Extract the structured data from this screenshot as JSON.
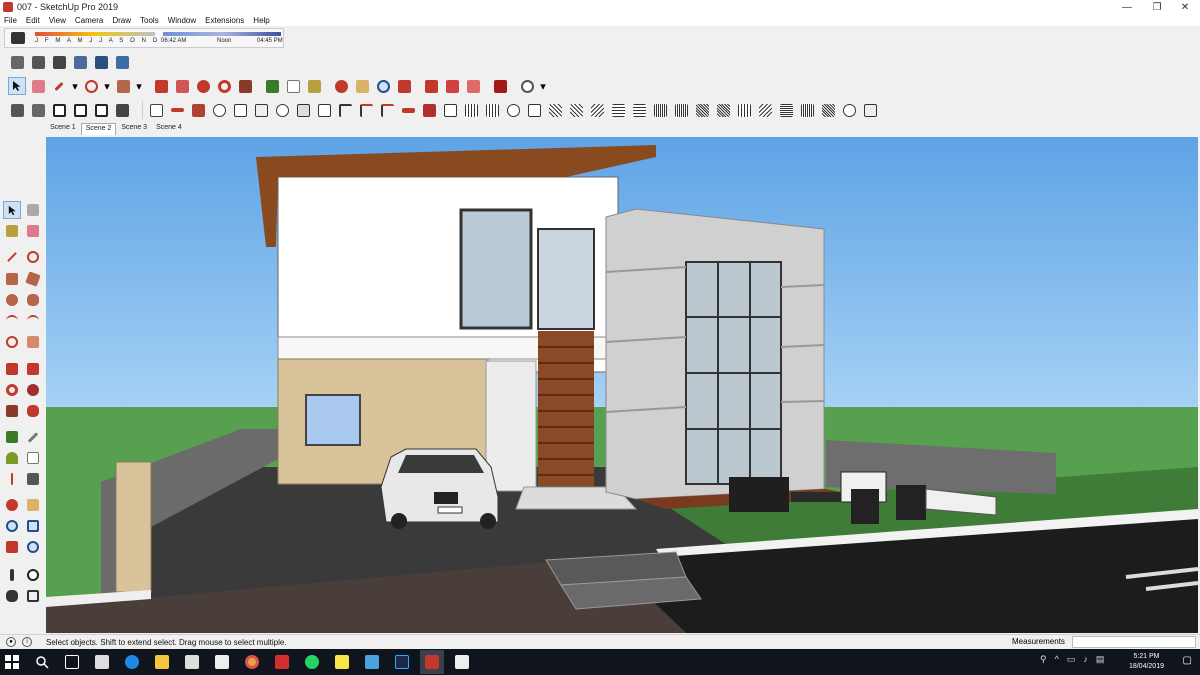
{
  "window": {
    "title": "007 - SketchUp Pro 2019",
    "minimize_glyph": "—",
    "restore_glyph": "❐",
    "close_glyph": "✕"
  },
  "menu": [
    "File",
    "Edit",
    "View",
    "Camera",
    "Draw",
    "Tools",
    "Window",
    "Extensions",
    "Help"
  ],
  "shadows": {
    "months": "J F M A M J J A S O N D",
    "time_start": "06:42 AM",
    "time_noon": "Noon",
    "time_end": "04:45 PM"
  },
  "scenes": [
    "Scene 1",
    "Scene 2",
    "Scene 3",
    "Scene 4"
  ],
  "active_scene_index": 1,
  "status": {
    "hint": "Select objects. Shift to extend select. Drag mouse to select multiple.",
    "measurements_label": "Measurements",
    "measurements_value": ""
  },
  "taskbar": {
    "time": "5:21 PM",
    "date": "18/04/2019"
  },
  "toolbar_icons": {
    "row1": [
      "shadow-settings-icon"
    ],
    "row2": [
      "styles-icon",
      "xray-icon",
      "back-edges-icon",
      "wireframe-icon",
      "shaded-textures-icon"
    ],
    "row3": [
      "select-icon",
      "eraser-icon",
      "pencil-icon",
      "arc-icon",
      "rectangle-icon",
      "pushpull-icon",
      "followme-icon",
      "move-icon",
      "rotate-icon",
      "scale-icon",
      "tape-icon",
      "text-icon",
      "orbit-icon",
      "pan-icon",
      "zoom-icon",
      "zoom-extents-icon",
      "warehouse-icon",
      "extension-icon",
      "ruby-icon",
      "account-icon"
    ],
    "row4": [
      "iso-view-icon",
      "top-view-icon",
      "front-view-icon",
      "right-view-icon",
      "back-view-icon",
      "left-view-icon",
      "sandbox-icons"
    ]
  },
  "colors": {
    "sky": "#7cb8ee",
    "grass": "#57a04f",
    "accent_red": "#c0392b",
    "roof": "#8a4a1f",
    "taskbar": "#10141c"
  }
}
